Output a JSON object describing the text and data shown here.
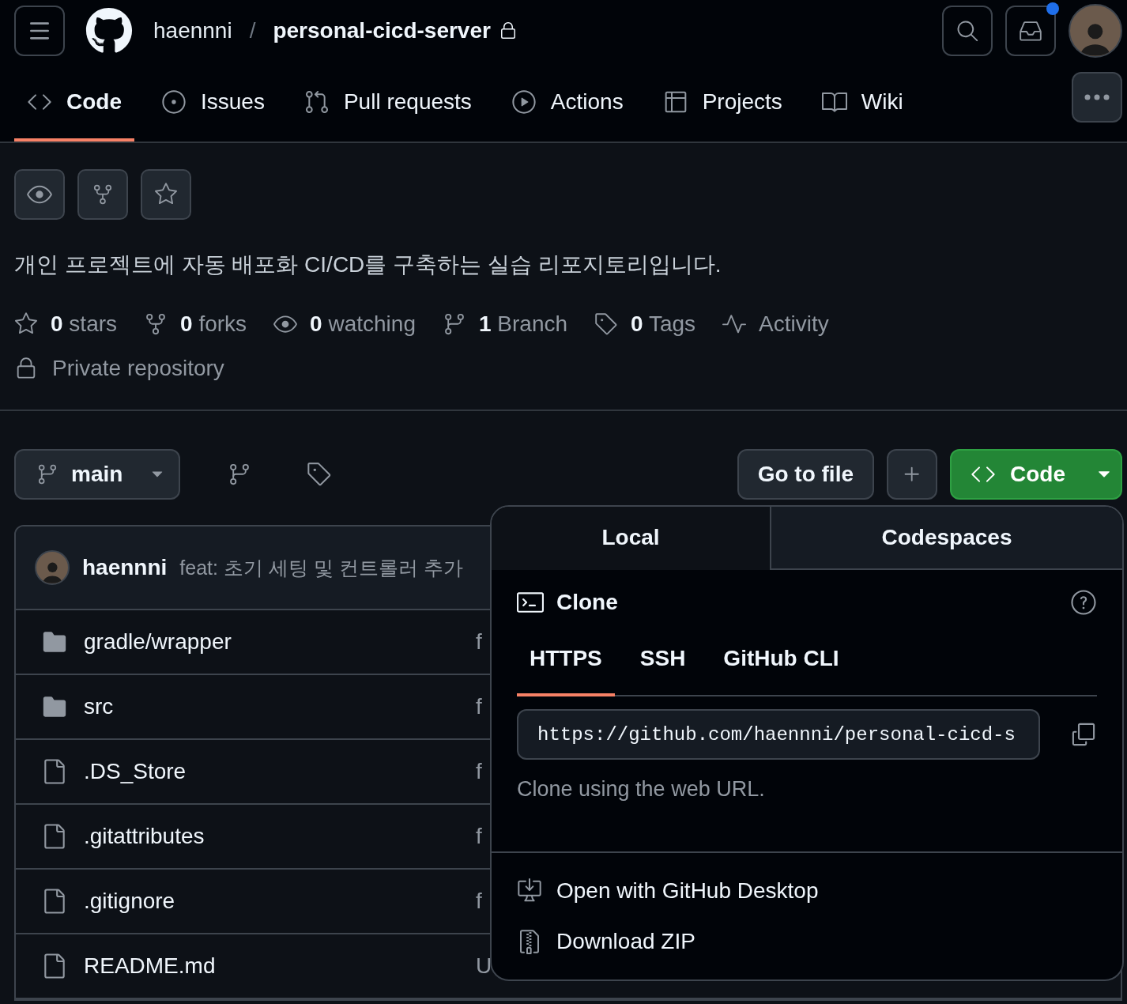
{
  "header": {
    "owner": "haennni",
    "separator": "/",
    "repo": "personal-cicd-server",
    "private": true,
    "notification_dot": true
  },
  "nav": [
    {
      "label": "Code",
      "selected": true
    },
    {
      "label": "Issues",
      "selected": false
    },
    {
      "label": "Pull requests",
      "selected": false
    },
    {
      "label": "Actions",
      "selected": false
    },
    {
      "label": "Projects",
      "selected": false
    },
    {
      "label": "Wiki",
      "selected": false
    }
  ],
  "description": "개인 프로젝트에 자동 배포화 CI/CD를 구축하는 실습 리포지토리입니다.",
  "stats": [
    "**0** stars",
    "**0** forks",
    "**0** watching",
    "**1** Branch",
    "**0** Tags",
    "Activity"
  ],
  "visibility": "Private repository",
  "branch": "main",
  "toolbar": {
    "go_to_file": "Go to file",
    "code_button": "Code"
  },
  "latest_commit": {
    "author": "haennni",
    "message": "feat: 초기 세팅 및 컨트롤러 추가"
  },
  "files": [
    {
      "name": "gradle/wrapper",
      "kind": "folder",
      "column_2": "f"
    },
    {
      "name": "src",
      "kind": "folder",
      "column_2": "f"
    },
    {
      "name": ".DS_Store",
      "kind": "file",
      "column_2": "f"
    },
    {
      "name": ".gitattributes",
      "kind": "file",
      "column_2": "f"
    },
    {
      "name": ".gitignore",
      "kind": "file",
      "column_2": "f"
    },
    {
      "name": "README.md",
      "kind": "file",
      "column_2": "U"
    }
  ],
  "clone_popup": {
    "tabs": [
      {
        "label": "Local",
        "selected": true
      },
      {
        "label": "Codespaces",
        "selected": false
      }
    ],
    "title": "Clone",
    "protocols": [
      {
        "label": "HTTPS",
        "selected": true
      },
      {
        "label": "SSH",
        "selected": false
      },
      {
        "label": "GitHub CLI",
        "selected": false
      }
    ],
    "url": "https://github.com/haennni/personal-cicd-s",
    "hint": "Clone using the web URL.",
    "actions": [
      "Open with GitHub Desktop",
      "Download ZIP"
    ]
  }
}
